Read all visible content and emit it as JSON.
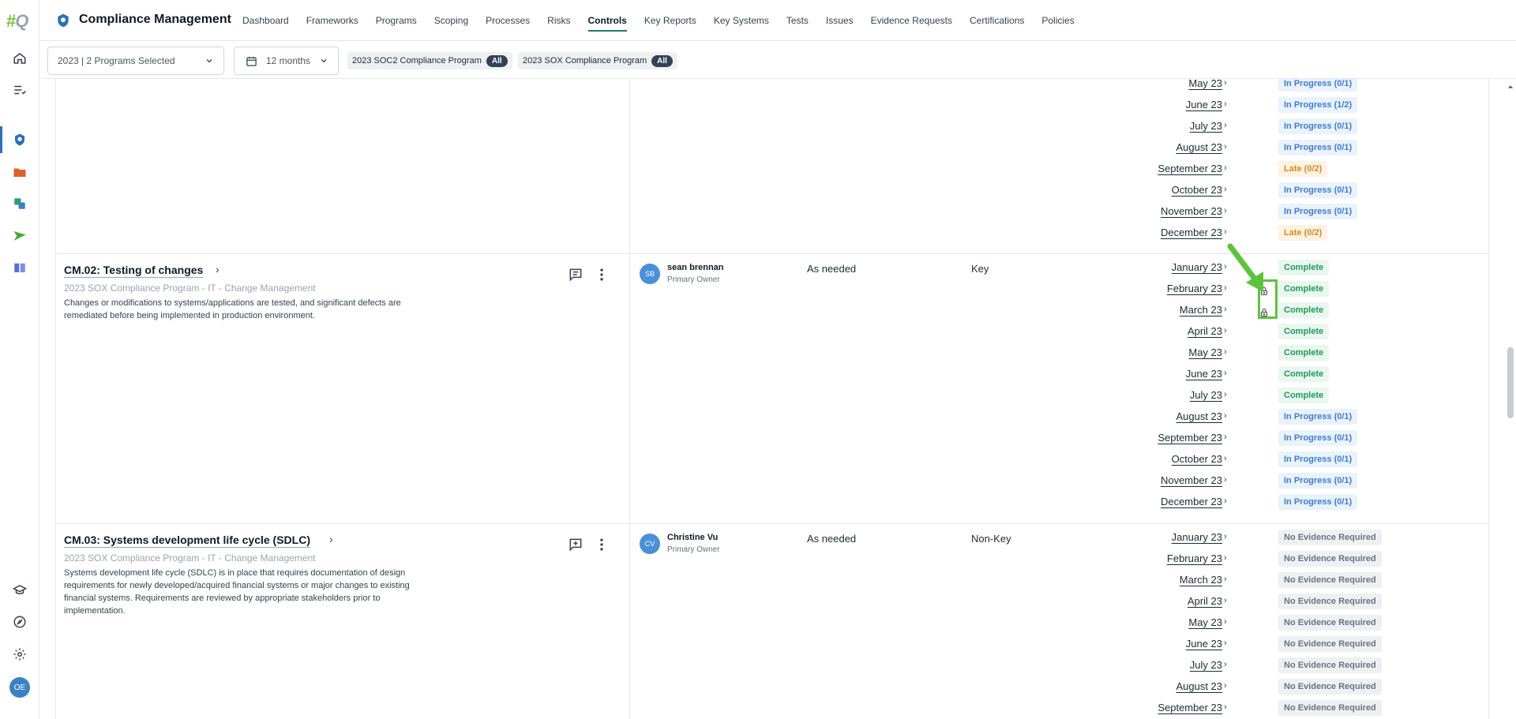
{
  "app": {
    "title": "Compliance Management"
  },
  "nav": [
    {
      "label": "Dashboard"
    },
    {
      "label": "Frameworks"
    },
    {
      "label": "Programs"
    },
    {
      "label": "Scoping"
    },
    {
      "label": "Processes"
    },
    {
      "label": "Risks"
    },
    {
      "label": "Controls",
      "active": true
    },
    {
      "label": "Key Reports"
    },
    {
      "label": "Key Systems"
    },
    {
      "label": "Tests"
    },
    {
      "label": "Issues"
    },
    {
      "label": "Evidence Requests"
    },
    {
      "label": "Certifications"
    },
    {
      "label": "Policies"
    }
  ],
  "filters": {
    "program_select": "2023 | 2 Programs Selected",
    "period_select": "12 months",
    "chips": [
      {
        "label": "2023 SOC2 Compliance Program",
        "tag": "All"
      },
      {
        "label": "2023 SOX Compliance Program",
        "tag": "All"
      }
    ]
  },
  "user": {
    "initials": "OE"
  },
  "prev_rows": [
    {
      "period": "May 23",
      "status": "In Progress (0/1)",
      "kind": "inprogress"
    },
    {
      "period": "June 23",
      "status": "In Progress (1/2)",
      "kind": "inprogress"
    },
    {
      "period": "July 23",
      "status": "In Progress (0/1)",
      "kind": "inprogress"
    },
    {
      "period": "August 23",
      "status": "In Progress (0/1)",
      "kind": "inprogress"
    },
    {
      "period": "September 23",
      "status": "Late (0/2)",
      "kind": "late"
    },
    {
      "period": "October 23",
      "status": "In Progress (0/1)",
      "kind": "inprogress"
    },
    {
      "period": "November 23",
      "status": "In Progress (0/1)",
      "kind": "inprogress"
    },
    {
      "period": "December 23",
      "status": "Late (0/2)",
      "kind": "late"
    }
  ],
  "controls": [
    {
      "title": "CM.02: Testing of changes",
      "subtitle": "2023 SOX Compliance Program - IT - Change Management",
      "description": "Changes or modifications to systems/applications are tested, and significant defects are remediated before being implemented in production environment.",
      "owner_initials": "SB",
      "owner_name": "sean brennan",
      "owner_role": "Primary Owner",
      "frequency": "As needed",
      "key": "Key",
      "periods": [
        {
          "period": "January 23",
          "status": "Complete",
          "kind": "complete"
        },
        {
          "period": "February 23",
          "status": "Complete",
          "kind": "complete",
          "locked": true
        },
        {
          "period": "March 23",
          "status": "Complete",
          "kind": "complete",
          "locked": true
        },
        {
          "period": "April 23",
          "status": "Complete",
          "kind": "complete"
        },
        {
          "period": "May 23",
          "status": "Complete",
          "kind": "complete"
        },
        {
          "period": "June 23",
          "status": "Complete",
          "kind": "complete"
        },
        {
          "period": "July 23",
          "status": "Complete",
          "kind": "complete"
        },
        {
          "period": "August 23",
          "status": "In Progress (0/1)",
          "kind": "inprogress"
        },
        {
          "period": "September 23",
          "status": "In Progress (0/1)",
          "kind": "inprogress"
        },
        {
          "period": "October 23",
          "status": "In Progress (0/1)",
          "kind": "inprogress"
        },
        {
          "period": "November 23",
          "status": "In Progress (0/1)",
          "kind": "inprogress"
        },
        {
          "period": "December 23",
          "status": "In Progress (0/1)",
          "kind": "inprogress"
        }
      ]
    },
    {
      "title": "CM.03: Systems development life cycle (SDLC)",
      "subtitle": "2023 SOX Compliance Program - IT - Change Management",
      "description": "Systems development life cycle (SDLC) is in place that requires documentation of design requirements for newly developed/acquired financial systems or major changes to existing financial systems. Requirements are reviewed by appropriate stakeholders prior to implementation.",
      "owner_initials": "CV",
      "owner_name": "Christine Vu",
      "owner_role": "Primary Owner",
      "frequency": "As needed",
      "key": "Non-Key",
      "periods": [
        {
          "period": "January 23",
          "status": "No Evidence Required",
          "kind": "none"
        },
        {
          "period": "February 23",
          "status": "No Evidence Required",
          "kind": "none"
        },
        {
          "period": "March 23",
          "status": "No Evidence Required",
          "kind": "none"
        },
        {
          "period": "April 23",
          "status": "No Evidence Required",
          "kind": "none"
        },
        {
          "period": "May 23",
          "status": "No Evidence Required",
          "kind": "none"
        },
        {
          "period": "June 23",
          "status": "No Evidence Required",
          "kind": "none"
        },
        {
          "period": "July 23",
          "status": "No Evidence Required",
          "kind": "none"
        },
        {
          "period": "August 23",
          "status": "No Evidence Required",
          "kind": "none"
        },
        {
          "period": "September 23",
          "status": "No Evidence Required",
          "kind": "none"
        }
      ]
    }
  ]
}
